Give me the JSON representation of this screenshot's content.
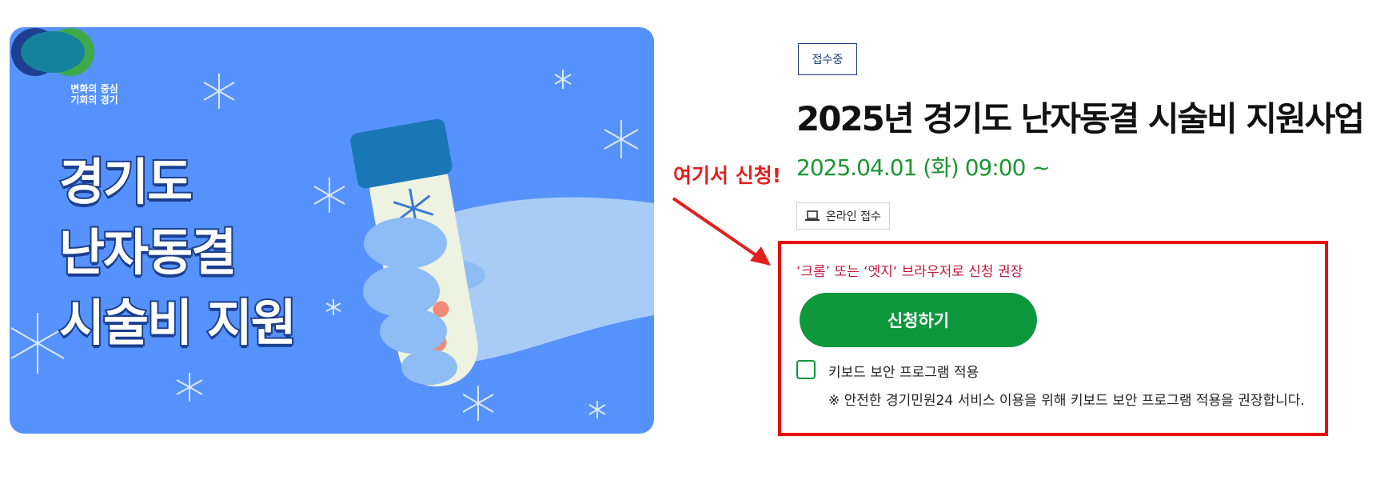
{
  "banner": {
    "logo_line1": "변화의 중심",
    "logo_line2": "기회의 경기",
    "title_line1": "경기도",
    "title_line2": "난자동결",
    "title_line3": "시술비 지원",
    "background_color": "#5692fb"
  },
  "annotation": {
    "text": "여기서 신청!",
    "color": "#e11f1f"
  },
  "detail": {
    "status_badge": "접수중",
    "title": "2025년 경기도 난자동결 시술비 지원사업",
    "date": "2025.04.01 (화) 09:00 ~",
    "channel_label": "온라인 접수",
    "channel_icon": "laptop-icon",
    "browser_notice": "‘크롬’ 또는 ‘엣지‘ 브라우저로 신청 권장",
    "apply_button": "신청하기",
    "keyboard_security_label": "키보드 보안 프로그램 적용",
    "keyboard_security_checked": false,
    "keyboard_security_note": "※ 안전한 경기민원24 서비스 이용을 위해 키보드 보안 프로그램 적용을 권장합니다.",
    "accent_color": "#0e973d"
  }
}
